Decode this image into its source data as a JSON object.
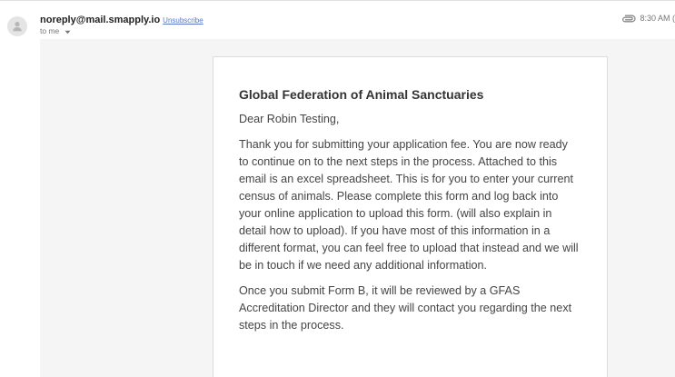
{
  "header": {
    "sender_email": "noreply@mail.smapply.io",
    "unsubscribe_label": "Unsubscribe",
    "recipient_label": "to me",
    "time": "8:30 AM (",
    "icons": {
      "avatar": "person-icon",
      "recipient_toggle": "caret-down-icon",
      "attachment": "paperclip-icon"
    }
  },
  "message": {
    "org_name": "Global Federation of Animal Sanctuaries",
    "greeting": "Dear Robin Testing,",
    "paragraphs": [
      "Thank you for submitting your application fee. You are now ready to continue on to the next steps in the process.  Attached to this email is an excel spreadsheet. This is for you to enter your current census of animals. Please complete this form and log back into your online application to upload this form. (will also explain in detail how to upload). If you have most of this information in a different format, you can feel free to upload that instead and we will be in touch if we need any additional information.",
      "Once you submit Form B, it will be reviewed by a GFAS Accreditation Director and they will contact you regarding the next steps in the process."
    ]
  },
  "colors": {
    "link": "#5a76c9",
    "panel_bg": "#f5f5f5",
    "text": "#444444"
  }
}
